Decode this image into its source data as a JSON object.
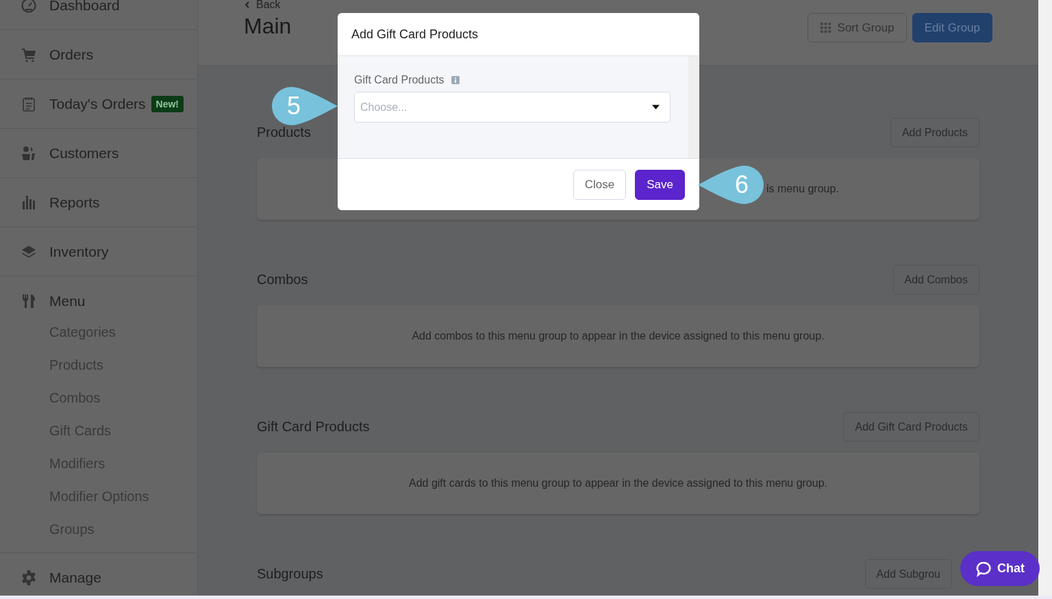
{
  "sidebar": {
    "items": [
      {
        "label": "Dashboard"
      },
      {
        "label": "Orders"
      },
      {
        "label": "Today's Orders",
        "badge": "New!"
      },
      {
        "label": "Customers"
      },
      {
        "label": "Reports"
      },
      {
        "label": "Inventory"
      },
      {
        "label": "Menu",
        "children": [
          {
            "label": "Categories"
          },
          {
            "label": "Products"
          },
          {
            "label": "Combos"
          },
          {
            "label": "Gift Cards"
          },
          {
            "label": "Modifiers"
          },
          {
            "label": "Modifier Options"
          },
          {
            "label": "Groups"
          }
        ]
      },
      {
        "label": "Manage"
      }
    ]
  },
  "header": {
    "back": "Back",
    "title": "Main",
    "buttons": [
      {
        "label": "Sort Group",
        "kind": "outline"
      },
      {
        "label": "Edit Group",
        "kind": "primary"
      }
    ]
  },
  "sections": [
    {
      "title": "Products",
      "button": "Add Products",
      "message": "is menu group."
    },
    {
      "title": "Combos",
      "button": "Add Combos",
      "message": "Add combos to this menu group to appear in the device assigned to this menu group."
    },
    {
      "title": "Gift Card Products",
      "button": "Add Gift Card Products",
      "message": "Add gift cards to this menu group to appear in the device assigned to this menu group."
    },
    {
      "title": "Subgroups",
      "button": "Add Subgrou"
    }
  ],
  "modal": {
    "title": "Add Gift Card Products",
    "field_label": "Gift Card Products",
    "placeholder": "Choose...",
    "buttons": [
      {
        "label": "Close",
        "kind": "outline"
      },
      {
        "label": "Save",
        "kind": "primary"
      }
    ]
  },
  "callouts": [
    "5",
    "6"
  ],
  "chat": {
    "label": "Chat"
  }
}
